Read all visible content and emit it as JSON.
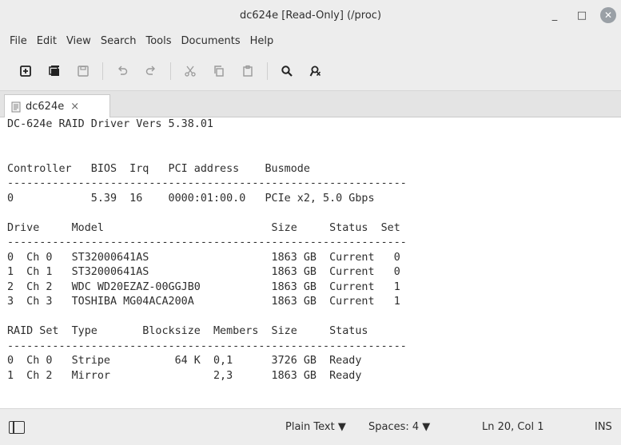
{
  "window": {
    "title": "dc624e [Read-Only] (/proc)",
    "minimize": "_",
    "maximize": "□",
    "close": "✕"
  },
  "menu": [
    "File",
    "Edit",
    "View",
    "Search",
    "Tools",
    "Documents",
    "Help"
  ],
  "toolbar_icons": [
    "new-document-icon",
    "open-icon",
    "save-icon",
    "undo-icon",
    "redo-icon",
    "cut-icon",
    "copy-icon",
    "paste-icon",
    "search-icon",
    "search-replace-icon"
  ],
  "tab": {
    "label": "dc624e",
    "close": "×"
  },
  "editor_lines": [
    "DC-624e RAID Driver Vers 5.38.01",
    "",
    "",
    "Controller   BIOS  Irq   PCI address    Busmode",
    "--------------------------------------------------------------",
    "0            5.39  16    0000:01:00.0   PCIe x2, 5.0 Gbps",
    "",
    "Drive     Model                          Size     Status  Set",
    "--------------------------------------------------------------",
    "0  Ch 0   ST32000641AS                   1863 GB  Current   0",
    "1  Ch 1   ST32000641AS                   1863 GB  Current   0",
    "2  Ch 2   WDC WD20EZAZ-00GGJB0           1863 GB  Current   1",
    "3  Ch 3   TOSHIBA MG04ACA200A            1863 GB  Current   1",
    "",
    "RAID Set  Type       Blocksize  Members  Size     Status",
    "--------------------------------------------------------------",
    "0  Ch 0   Stripe          64 K  0,1      3726 GB  Ready",
    "1  Ch 2   Mirror                2,3      1863 GB  Ready"
  ],
  "statusbar": {
    "language": "Plain Text ▼",
    "spaces": "Spaces: 4 ▼",
    "position": "Ln 20, Col 1",
    "mode": "INS"
  }
}
